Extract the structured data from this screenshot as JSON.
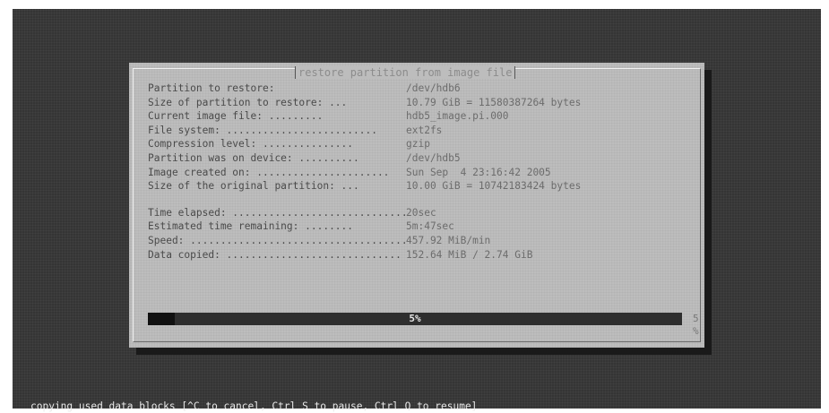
{
  "dialog": {
    "title": "restore partition from image file",
    "info": [
      {
        "label": "Partition to restore:",
        "value": "/dev/hdb6"
      },
      {
        "label": "Size of partition to restore: ...",
        "value": "10.79 GiB = 11580387264 bytes"
      },
      {
        "label": "Current image file: .........",
        "value": "hdb5_image.pi.000"
      },
      {
        "label": "File system: .........................",
        "value": "ext2fs"
      },
      {
        "label": "Compression level: ...............",
        "value": "gzip"
      },
      {
        "label": "Partition was on device: ..........",
        "value": "/dev/hdb5"
      },
      {
        "label": "Image created on: ......................",
        "value": "Sun Sep  4 23:16:42 2005"
      },
      {
        "label": "Size of the original partition: ...",
        "value": "10.00 GiB = 10742183424 bytes"
      }
    ],
    "progress_info": [
      {
        "label": "Time elapsed: .............................",
        "value": "20sec"
      },
      {
        "label": "Estimated time remaining: ........",
        "value": "5m:47sec"
      },
      {
        "label": "Speed: .......................................",
        "value": "457.92 MiB/min"
      },
      {
        "label": "Data copied: .............................",
        "value": "152.64 MiB / 2.74 GiB"
      }
    ],
    "progress": {
      "fraction": 0.05,
      "bar_label": "5%",
      "percent_label": "5 %"
    }
  },
  "status_line": "copying used data blocks [^C to cancel, Ctrl S to pause, Ctrl Q to resume]",
  "colors": {
    "screen_background": "#353535",
    "dialog_background": "#bdbdbd",
    "progress_bar": "#2e2e2e",
    "status_text": "#e8e8e8"
  }
}
